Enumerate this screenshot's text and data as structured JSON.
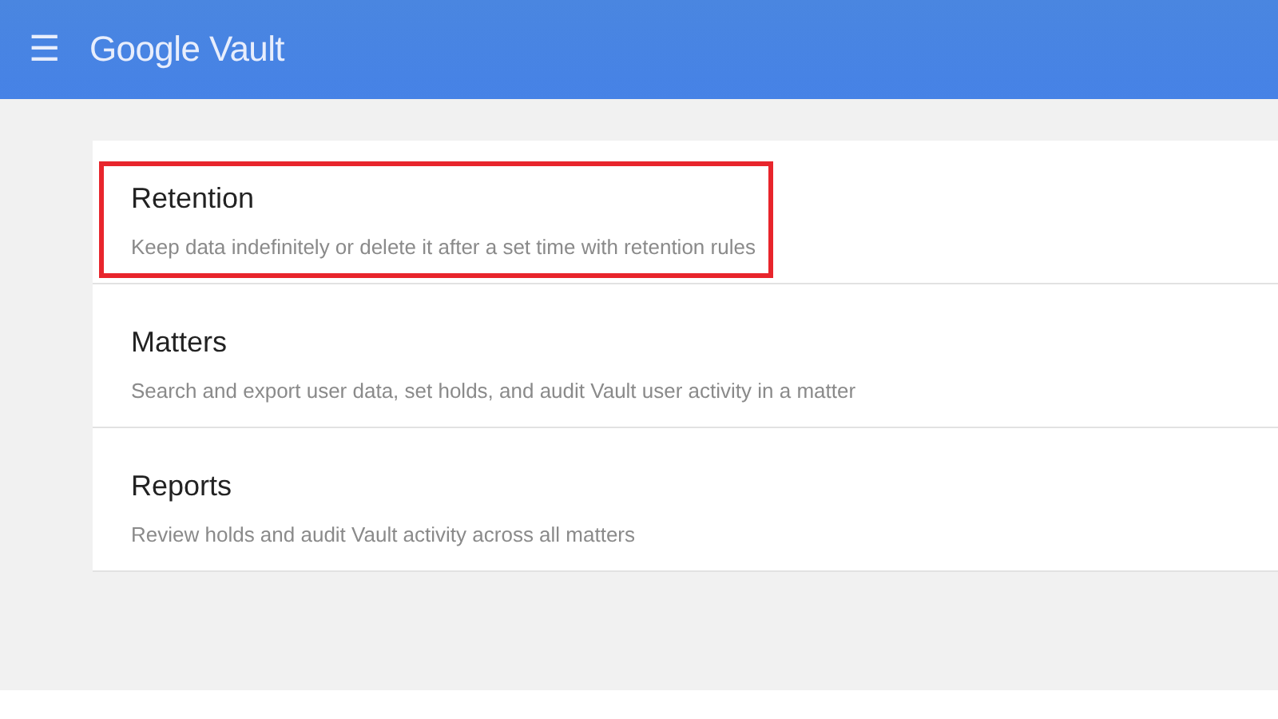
{
  "app_bar": {
    "menu_icon": "☰",
    "title": "Google Vault"
  },
  "items": [
    {
      "title": "Retention",
      "description": "Keep data indefinitely or delete it after a set time with retention rules",
      "highlighted": true
    },
    {
      "title": "Matters",
      "description": "Search and export user data, set holds, and audit Vault user activity in a matter",
      "highlighted": false
    },
    {
      "title": "Reports",
      "description": "Review holds and audit Vault activity across all matters",
      "highlighted": false
    }
  ]
}
